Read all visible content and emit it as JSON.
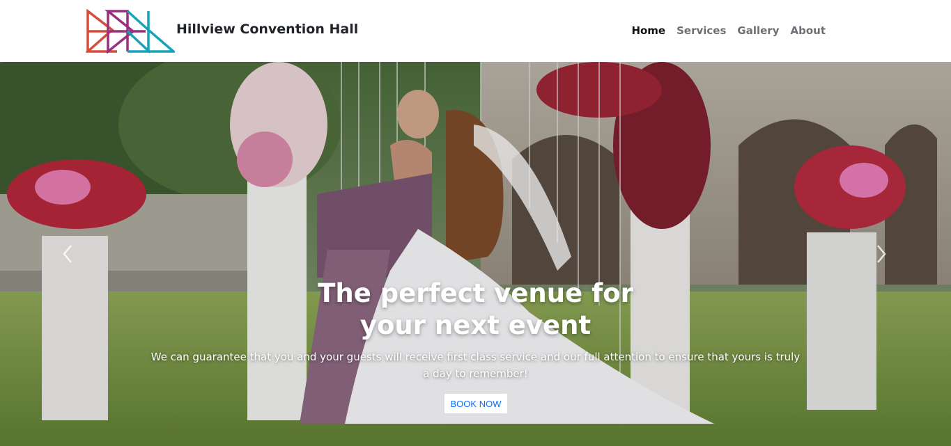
{
  "brand": {
    "name": "Hillview Convention Hall"
  },
  "nav": {
    "items": [
      "Home",
      "Services",
      "Gallery",
      "About"
    ],
    "active": "Home"
  },
  "hero": {
    "headline_line1": "The perfect venue for",
    "headline_line2": "your next event",
    "subtext": "We can guarantee that you and your guests will receive first class service and our full attention to ensure that yours is truly a day to remember!",
    "cta_label": "BOOK NOW"
  },
  "colors": {
    "logo_red": "#d64d3a",
    "logo_purple": "#9b2f7f",
    "logo_teal": "#17a2b8",
    "cta_text": "#0d6efd"
  },
  "icons": {
    "prev": "chevron-left-icon",
    "next": "chevron-right-icon"
  }
}
